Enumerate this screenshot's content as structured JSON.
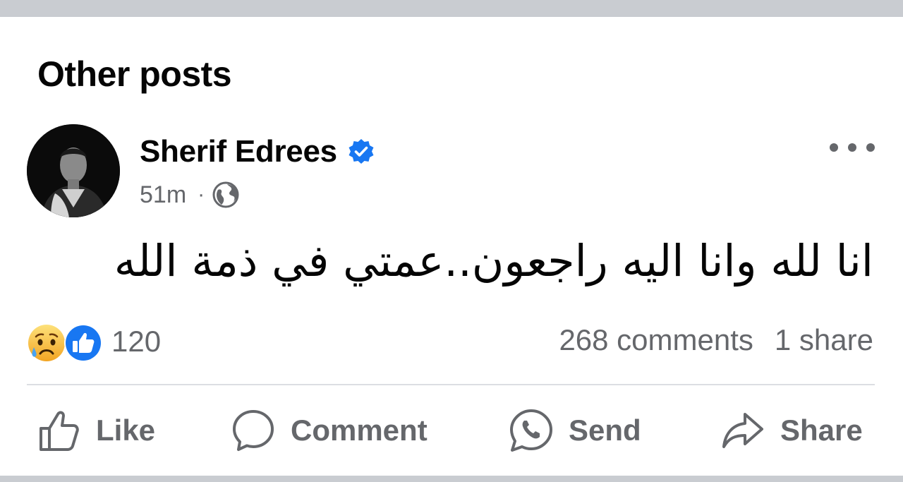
{
  "section": {
    "title": "Other posts"
  },
  "post": {
    "author": "Sherif Edrees",
    "verified": true,
    "time": "51m",
    "separator": "·",
    "audience_icon": "globe-icon",
    "text": "انا لله وانا اليه راجعون..عمتي في  ذمة الله",
    "reactions": {
      "types": [
        "sad",
        "like"
      ],
      "count": "120"
    },
    "comments": "268 comments",
    "shares": "1 share"
  },
  "actions": {
    "like": "Like",
    "comment": "Comment",
    "send": "Send",
    "share": "Share"
  },
  "colors": {
    "verified": "#1877f2",
    "like_react": "#1877f2",
    "sad_react": "#f7b125",
    "secondary_text": "#65676b",
    "band": "#c9ccd1"
  }
}
